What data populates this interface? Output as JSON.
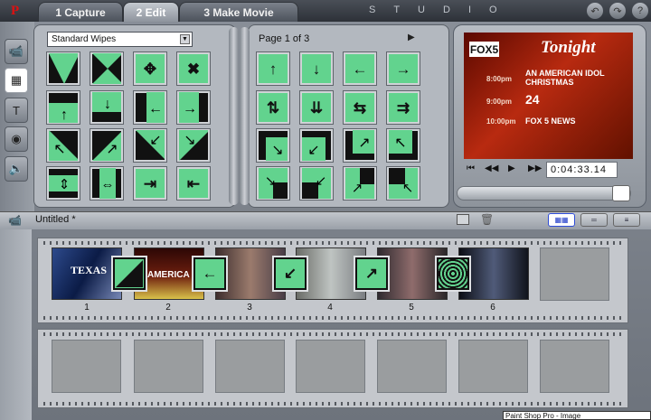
{
  "tabs": [
    "1 Capture",
    "2 Edit",
    "3 Make Movie"
  ],
  "brand": "STUDIO",
  "top_buttons": [
    "↶",
    "↷",
    "?"
  ],
  "tools": [
    "camera-icon",
    "film-edit-icon",
    "title-icon",
    "camera-photo-icon",
    "speaker-icon"
  ],
  "wipes": {
    "category": "Standard Wipes",
    "page_label": "Page 1 of 3",
    "next_label": "▶"
  },
  "preview": {
    "channel": "FOX5",
    "headline": "Tonight",
    "schedule": [
      {
        "time": "8:00pm",
        "show": "AN AMERICAN IDOL CHRISTMAS"
      },
      {
        "time": "9:00pm",
        "show": "24"
      },
      {
        "time": "10:00pm",
        "show": "FOX 5 NEWS"
      }
    ],
    "timecode": "0:04:33.14",
    "transport": [
      "⏮",
      "◀◀",
      "▶",
      "▶▶"
    ]
  },
  "storyboard": {
    "title": "Untitled *",
    "clips": [
      "1",
      "2",
      "3",
      "4",
      "5",
      "6"
    ]
  },
  "statusbar": "Paint Shop Pro - Image"
}
